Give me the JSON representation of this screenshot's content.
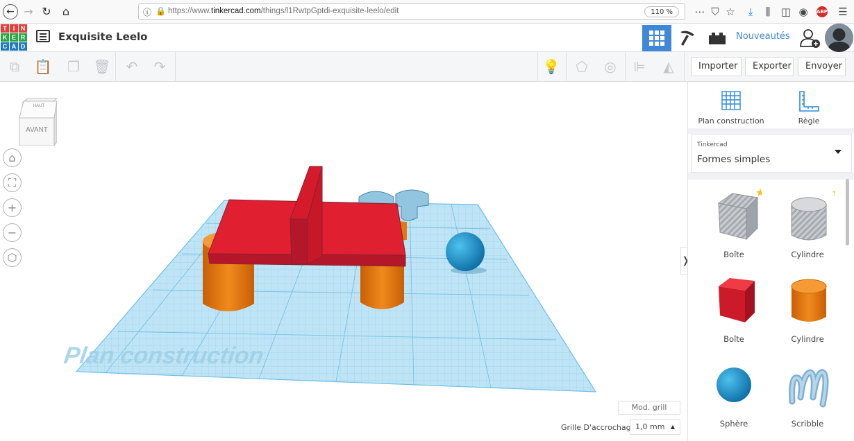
{
  "browser": {
    "url_prefix": "https://www.",
    "url_domain": "tinkercad.com",
    "url_path": "/things/l1RwtpGptdi-exquisite-leelo/edit",
    "zoom": "110 %"
  },
  "header": {
    "logo_letters": [
      "T",
      "I",
      "N",
      "K",
      "E",
      "R",
      "C",
      "A",
      "D"
    ],
    "project_title": "Exquisite Leelo",
    "news_label": "Nouveautés"
  },
  "toolbar": {
    "import_label": "Importer",
    "export_label": "Exporter",
    "send_label": "Envoyer"
  },
  "viewport": {
    "viewcube_top": "HAUT",
    "viewcube_front": "AVANT",
    "workplane_label": "Plan construction",
    "grid_mod_label": "Mod. grill",
    "snap_label": "Grille D'accrochage",
    "snap_value": "1,0 mm"
  },
  "panel": {
    "workplane_tool": "Plan construction",
    "ruler_tool": "Règle",
    "library_source": "Tinkercad",
    "library_name": "Formes simples",
    "shapes": [
      {
        "label": "Boîte",
        "icon": "box-hole-icon",
        "starred": true
      },
      {
        "label": "Cylindre",
        "icon": "cylinder-hole-icon",
        "starred": true
      },
      {
        "label": "Boîte",
        "icon": "box-red-icon",
        "starred": false
      },
      {
        "label": "Cylindre",
        "icon": "cylinder-orange-icon",
        "starred": false
      },
      {
        "label": "Sphère",
        "icon": "sphere-blue-icon",
        "starred": false
      },
      {
        "label": "Scribble",
        "icon": "scribble-icon",
        "starred": false
      }
    ]
  },
  "colors": {
    "accent": "#3f88d8",
    "red": "#e0202f",
    "orange": "#e9790f",
    "blue": "#1d9bd6",
    "grid": "#9fd4ee"
  }
}
